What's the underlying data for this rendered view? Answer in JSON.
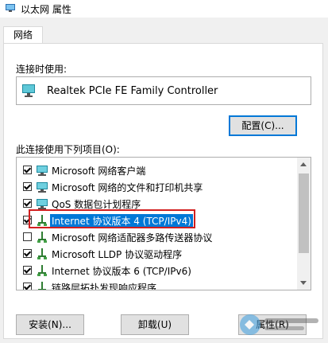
{
  "window": {
    "title": "以太网 属性"
  },
  "tabs": [
    {
      "label": "网络"
    }
  ],
  "connect_using": {
    "label": "连接时使用:",
    "adapter": "Realtek PCIe FE Family Controller",
    "configure_label": "配置(C)..."
  },
  "items_section": {
    "label": "此连接使用下列项目(O):"
  },
  "items": [
    {
      "label": "Microsoft 网络客户端",
      "checked": true,
      "icon": "network-client-icon"
    },
    {
      "label": "Microsoft 网络的文件和打印机共享",
      "checked": true,
      "icon": "network-client-icon"
    },
    {
      "label": "QoS 数据包计划程序",
      "checked": true,
      "icon": "network-client-icon"
    },
    {
      "label": "Internet 协议版本 4 (TCP/IPv4)",
      "checked": true,
      "icon": "protocol-icon",
      "selected": true
    },
    {
      "label": "Microsoft 网络适配器多路传送器协议",
      "checked": false,
      "icon": "protocol-icon"
    },
    {
      "label": "Microsoft LLDP 协议驱动程序",
      "checked": true,
      "icon": "protocol-icon"
    },
    {
      "label": "Internet 协议版本 6 (TCP/IPv6)",
      "checked": true,
      "icon": "protocol-icon"
    },
    {
      "label": "链路层拓扑发现响应程序",
      "checked": true,
      "icon": "protocol-icon"
    }
  ],
  "buttons": {
    "install": "安装(N)...",
    "uninstall": "卸载(U)",
    "properties": "属性(R)"
  },
  "colors": {
    "selection": "#0078d7",
    "highlight_border": "#d21f1f",
    "window_bg": "#f0f0f0"
  }
}
